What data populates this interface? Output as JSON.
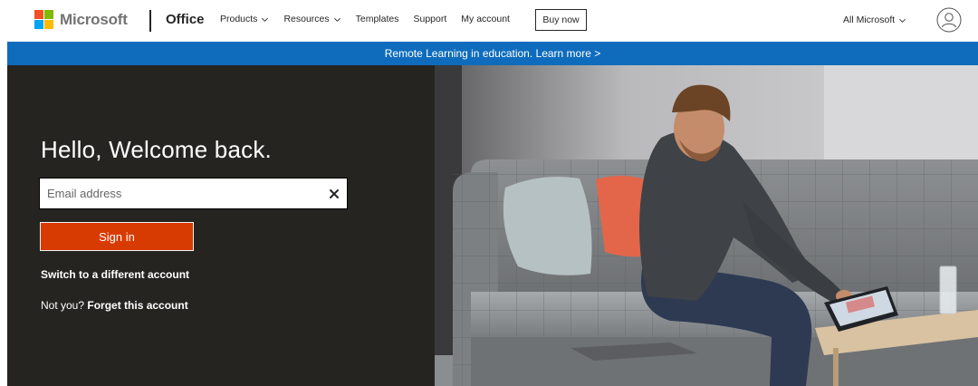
{
  "header": {
    "brand": "Microsoft",
    "product": "Office",
    "nav": [
      {
        "label": "Products",
        "dropdown": true
      },
      {
        "label": "Resources",
        "dropdown": true
      },
      {
        "label": "Templates",
        "dropdown": false
      },
      {
        "label": "Support",
        "dropdown": false
      },
      {
        "label": "My account",
        "dropdown": false
      }
    ],
    "buy_now": "Buy now",
    "all_microsoft": "All Microsoft",
    "logo_colors": [
      "#f25022",
      "#7fba00",
      "#00a4ef",
      "#ffb900"
    ]
  },
  "banner": {
    "text": "Remote Learning in education. Learn more >",
    "color": "#0f6cbd"
  },
  "signin": {
    "heading": "Hello, Welcome back.",
    "email_placeholder": "Email address",
    "email_value": "",
    "button_label": "Sign in",
    "button_color": "#d83b01",
    "switch_account": "Switch to a different account",
    "not_you": "Not you?",
    "forget_account": "Forget this account"
  },
  "icons": {
    "avatar": "user-avatar-icon",
    "clear": "close-icon",
    "dropdown": "chevron-down-icon"
  }
}
